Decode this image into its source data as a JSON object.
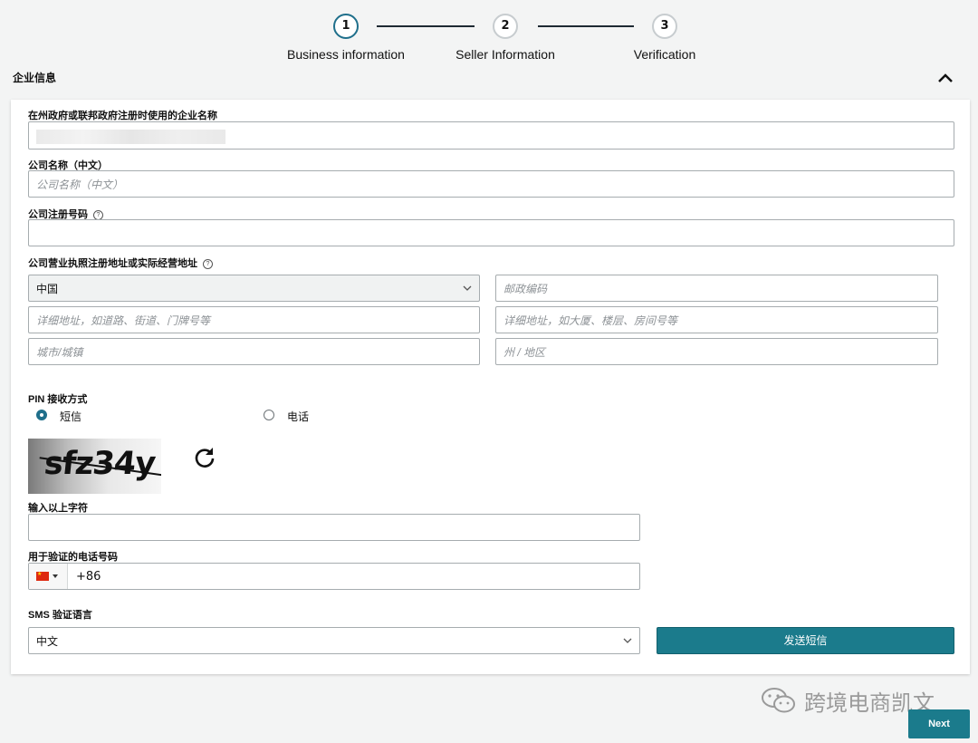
{
  "stepper": {
    "steps": [
      {
        "number": "1",
        "label": "Business information"
      },
      {
        "number": "2",
        "label": "Seller Information"
      },
      {
        "number": "3",
        "label": "Verification"
      }
    ]
  },
  "section": {
    "title": "企业信息"
  },
  "form": {
    "legal_name_label": "在州政府或联邦政府注册时使用的企业名称",
    "company_cn_label": "公司名称（中文）",
    "company_cn_placeholder": "公司名称（中文）",
    "reg_number_label": "公司注册号码",
    "address_label": "公司营业执照注册地址或实际经营地址",
    "country_value": "中国",
    "postal_placeholder": "邮政编码",
    "address1_placeholder": "详细地址，如道路、街道、门牌号等",
    "address2_placeholder": "详细地址，如大厦、楼层、房间号等",
    "city_placeholder": "城市/城镇",
    "state_placeholder": "州 / 地区",
    "pin_label": "PIN 接收方式",
    "pin_options": [
      {
        "label": "短信",
        "selected": true
      },
      {
        "label": "电话",
        "selected": false
      }
    ],
    "captcha_text": "sfz34y",
    "captcha_input_label": "输入以上字符",
    "phone_label": "用于验证的电话号码",
    "phone_prefix": "+86",
    "sms_lang_label": "SMS 验证语言",
    "sms_lang_value": "中文",
    "send_sms_label": "发送短信"
  },
  "watermark": {
    "text": "跨境电商凯文"
  },
  "footer": {
    "next_label": "Next"
  },
  "colors": {
    "accent": "#1b7b8c",
    "active_step": "#1f6f8b"
  }
}
